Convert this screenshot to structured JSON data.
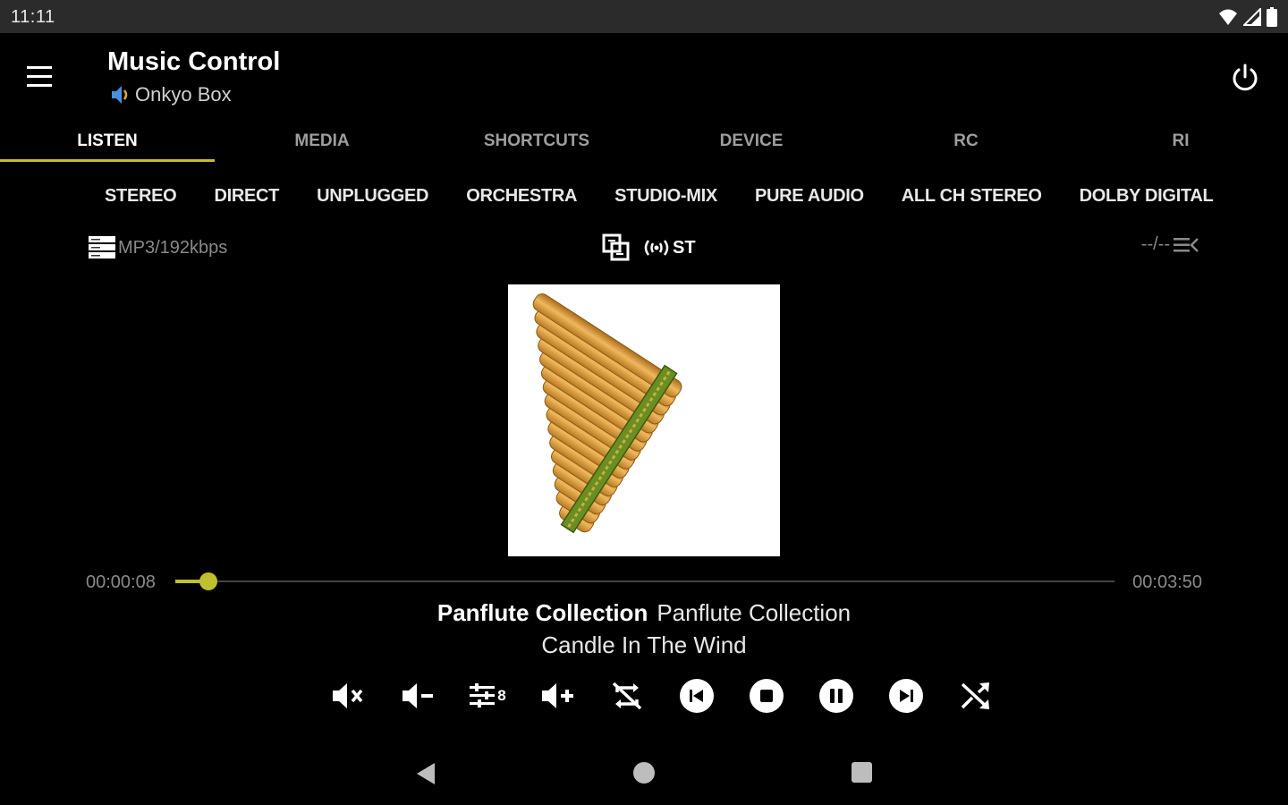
{
  "status_bar": {
    "time": "11:11"
  },
  "app_bar": {
    "title": "Music Control",
    "device_name": "Onkyo Box"
  },
  "tabs": [
    {
      "label": "LISTEN",
      "active": true
    },
    {
      "label": "MEDIA",
      "active": false
    },
    {
      "label": "SHORTCUTS",
      "active": false
    },
    {
      "label": "DEVICE",
      "active": false
    },
    {
      "label": "RC",
      "active": false
    },
    {
      "label": "RI",
      "active": false
    }
  ],
  "listening_modes": [
    "STEREO",
    "DIRECT",
    "UNPLUGGED",
    "ORCHESTRA",
    "STUDIO-MIX",
    "PURE AUDIO",
    "ALL CH STEREO",
    "DOLBY DIGITAL"
  ],
  "info": {
    "codec": "MP3/192kbps",
    "tuner_mode": "ST",
    "track_position": "--/--"
  },
  "playback": {
    "elapsed": "00:00:08",
    "total": "00:03:50",
    "progress_fraction": 0.035,
    "album": "Panflute Collection",
    "artist": "Panflute Collection",
    "title": "Candle In The Wind"
  },
  "controls": [
    {
      "name": "mute-button",
      "icon": "volume-mute-icon"
    },
    {
      "name": "volume-down-button",
      "icon": "volume-down-icon"
    },
    {
      "name": "equalizer-button",
      "icon": "equalizer-icon",
      "value": "8"
    },
    {
      "name": "volume-up-button",
      "icon": "volume-up-icon"
    },
    {
      "name": "repeat-button",
      "icon": "repeat-off-icon"
    },
    {
      "name": "previous-button",
      "icon": "skip-previous-icon"
    },
    {
      "name": "stop-button",
      "icon": "stop-icon"
    },
    {
      "name": "pause-button",
      "icon": "pause-icon"
    },
    {
      "name": "next-button",
      "icon": "skip-next-icon"
    },
    {
      "name": "shuffle-button",
      "icon": "shuffle-icon"
    }
  ],
  "colors": {
    "accent": "#c0c02c",
    "background": "#000000",
    "status_bar": "#2b2b2b"
  }
}
